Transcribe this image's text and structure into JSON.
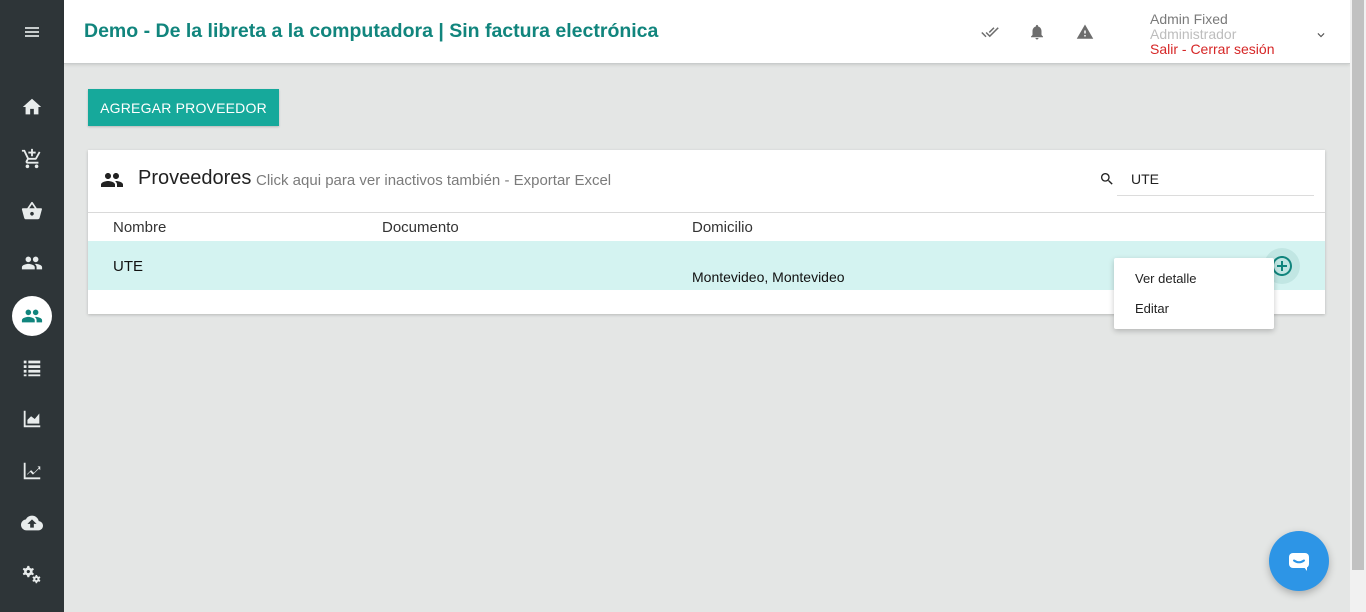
{
  "app": {
    "title": "Demo - De la libreta a la computadora | Sin factura electrónica"
  },
  "sidebar": {
    "items": [
      {
        "icon": "menu-icon"
      },
      {
        "icon": "home-icon"
      },
      {
        "icon": "cart-add-icon"
      },
      {
        "icon": "basket-icon"
      },
      {
        "icon": "users-icon"
      },
      {
        "icon": "suppliers-icon",
        "active": true
      },
      {
        "icon": "list-icon"
      },
      {
        "icon": "area-chart-icon"
      },
      {
        "icon": "trending-icon"
      },
      {
        "icon": "cloud-upload-icon"
      },
      {
        "icon": "settings-icon"
      }
    ]
  },
  "header": {
    "icons": [
      "double-check-icon",
      "bell-icon",
      "warning-icon"
    ],
    "user": {
      "name": "Admin Fixed",
      "role": "Administrador",
      "logout": "Salir - Cerrar sesión"
    }
  },
  "toolbar": {
    "add_label": "AGREGAR PROVEEDOR"
  },
  "card": {
    "title": "Proveedores",
    "subtitle": "Click aqui para ver inactivos también - Exportar Excel"
  },
  "search": {
    "value": "UTE",
    "placeholder": ""
  },
  "table": {
    "columns": [
      "Nombre",
      "Documento",
      "Domicilio"
    ],
    "rows": [
      {
        "nombre": "UTE",
        "documento": "",
        "domicilio": "Montevideo, Montevideo"
      }
    ]
  },
  "row_menu": {
    "items": [
      "Ver detalle",
      "Editar"
    ]
  },
  "colors": {
    "accent": "#16a99b",
    "title": "#11857d",
    "sidebar": "#2e3538",
    "row_highlight": "#d4f3f1",
    "logout": "#d62626",
    "chat": "#2d95e6"
  }
}
